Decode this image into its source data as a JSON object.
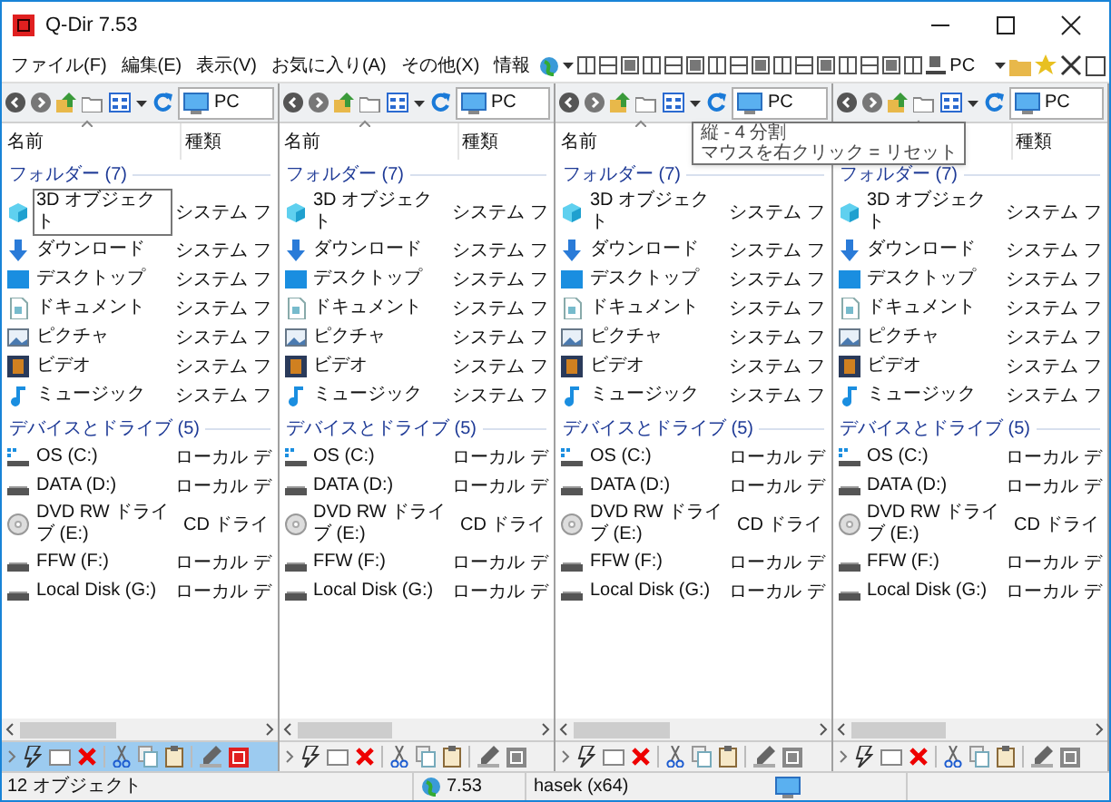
{
  "window": {
    "title": "Q-Dir 7.53"
  },
  "menu": [
    "ファイル(F)",
    "編集(E)",
    "表示(V)",
    "お気に入り(A)",
    "その他(X)",
    "情報"
  ],
  "toolbar": {
    "location": "PC"
  },
  "tooltip": {
    "lines": [
      "縦 - 4 分割",
      "マウスを右クリック = リセット"
    ]
  },
  "panes": [
    {
      "active": true,
      "address": "PC",
      "header": {
        "name": "名前",
        "type": "種類"
      },
      "groups": [
        {
          "title": "フォルダー (7)",
          "items": [
            {
              "name": "3D オブジェクト",
              "type": "システム フ",
              "focused": true
            },
            {
              "name": "ダウンロード",
              "type": "システム フ",
              "focused": false
            },
            {
              "name": "デスクトップ",
              "type": "システム フ",
              "focused": false
            },
            {
              "name": "ドキュメント",
              "type": "システム フ",
              "focused": false
            },
            {
              "name": "ピクチャ",
              "type": "システム フ",
              "focused": false
            },
            {
              "name": "ビデオ",
              "type": "システム フ",
              "focused": false
            },
            {
              "name": "ミュージック",
              "type": "システム フ",
              "focused": false
            }
          ]
        },
        {
          "title": "デバイスとドライブ (5)",
          "items": [
            {
              "name": "OS (C:)",
              "type": "ローカル デ",
              "focused": false
            },
            {
              "name": "DATA (D:)",
              "type": "ローカル デ",
              "focused": false
            },
            {
              "name": "DVD RW ドライブ (E:)",
              "type": "CD ドライ",
              "focused": false
            },
            {
              "name": "FFW (F:)",
              "type": "ローカル デ",
              "focused": false
            },
            {
              "name": "Local Disk (G:)",
              "type": "ローカル デ",
              "focused": false
            }
          ]
        }
      ]
    },
    {
      "active": false,
      "address": "PC",
      "header": {
        "name": "名前",
        "type": "種類"
      },
      "groups": [
        {
          "title": "フォルダー (7)",
          "items": [
            {
              "name": "3D オブジェクト",
              "type": "システム フ",
              "focused": false
            },
            {
              "name": "ダウンロード",
              "type": "システム フ",
              "focused": false
            },
            {
              "name": "デスクトップ",
              "type": "システム フ",
              "focused": false
            },
            {
              "name": "ドキュメント",
              "type": "システム フ",
              "focused": false
            },
            {
              "name": "ピクチャ",
              "type": "システム フ",
              "focused": false
            },
            {
              "name": "ビデオ",
              "type": "システム フ",
              "focused": false
            },
            {
              "name": "ミュージック",
              "type": "システム フ",
              "focused": false
            }
          ]
        },
        {
          "title": "デバイスとドライブ (5)",
          "items": [
            {
              "name": "OS (C:)",
              "type": "ローカル デ",
              "focused": false
            },
            {
              "name": "DATA (D:)",
              "type": "ローカル デ",
              "focused": false
            },
            {
              "name": "DVD RW ドライブ (E:)",
              "type": "CD ドライ",
              "focused": false
            },
            {
              "name": "FFW (F:)",
              "type": "ローカル デ",
              "focused": false
            },
            {
              "name": "Local Disk (G:)",
              "type": "ローカル デ",
              "focused": false
            }
          ]
        }
      ]
    },
    {
      "active": false,
      "address": "PC",
      "header": {
        "name": "名前"
      },
      "groups": [
        {
          "title": "フォルダー (7)",
          "items": [
            {
              "name": "3D オブジェクト",
              "type": "システム フ",
              "focused": false
            },
            {
              "name": "ダウンロード",
              "type": "システム フ",
              "focused": false
            },
            {
              "name": "デスクトップ",
              "type": "システム フ",
              "focused": false
            },
            {
              "name": "ドキュメント",
              "type": "システム フ",
              "focused": false
            },
            {
              "name": "ピクチャ",
              "type": "システム フ",
              "focused": false
            },
            {
              "name": "ビデオ",
              "type": "システム フ",
              "focused": false
            },
            {
              "name": "ミュージック",
              "type": "システム フ",
              "focused": false
            }
          ]
        },
        {
          "title": "デバイスとドライブ (5)",
          "items": [
            {
              "name": "OS (C:)",
              "type": "ローカル デ",
              "focused": false
            },
            {
              "name": "DATA (D:)",
              "type": "ローカル デ",
              "focused": false
            },
            {
              "name": "DVD RW ドライブ (E:)",
              "type": "CD ドライ",
              "focused": false
            },
            {
              "name": "FFW (F:)",
              "type": "ローカル デ",
              "focused": false
            },
            {
              "name": "Local Disk (G:)",
              "type": "ローカル デ",
              "focused": false
            }
          ]
        }
      ]
    },
    {
      "active": false,
      "address": "PC",
      "header": {
        "type": "種類"
      },
      "groups": [
        {
          "title": "フォルダー (7)",
          "items": [
            {
              "name": "3D オブジェクト",
              "type": "システム フ",
              "focused": false
            },
            {
              "name": "ダウンロード",
              "type": "システム フ",
              "focused": false
            },
            {
              "name": "デスクトップ",
              "type": "システム フ",
              "focused": false
            },
            {
              "name": "ドキュメント",
              "type": "システム フ",
              "focused": false
            },
            {
              "name": "ピクチャ",
              "type": "システム フ",
              "focused": false
            },
            {
              "name": "ビデオ",
              "type": "システム フ",
              "focused": false
            },
            {
              "name": "ミュージック",
              "type": "システム フ",
              "focused": false
            }
          ]
        },
        {
          "title": "デバイスとドライブ (5)",
          "items": [
            {
              "name": "OS (C:)",
              "type": "ローカル デ",
              "focused": false
            },
            {
              "name": "DATA (D:)",
              "type": "ローカル デ",
              "focused": false
            },
            {
              "name": "DVD RW ドライブ (E:)",
              "type": "CD ドライ",
              "focused": false
            },
            {
              "name": "FFW (F:)",
              "type": "ローカル デ",
              "focused": false
            },
            {
              "name": "Local Disk (G:)",
              "type": "ローカル デ",
              "focused": false
            }
          ]
        }
      ]
    }
  ],
  "status_bar": {
    "count": "12 オブジェクト",
    "version": "7.53",
    "user": "hasek (x64)"
  }
}
